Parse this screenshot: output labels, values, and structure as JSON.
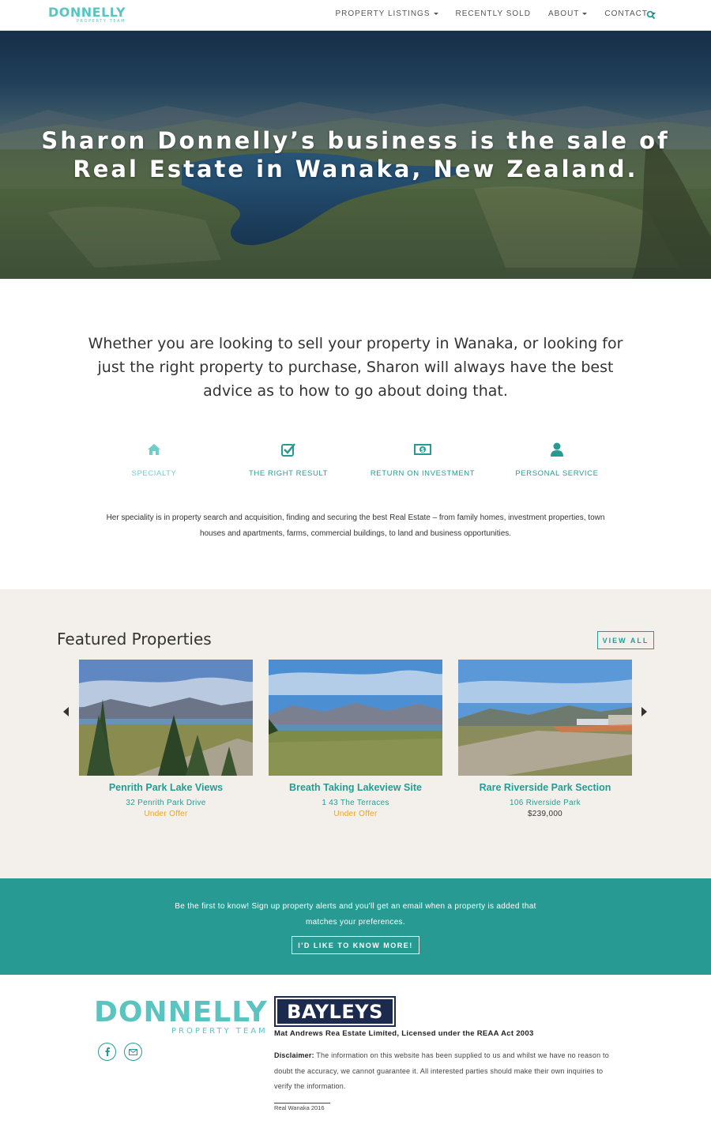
{
  "nav": {
    "logo_name": "DONNELLY",
    "logo_sub": "PROPERTY TEAM",
    "items": [
      {
        "label": "PROPERTY LISTINGS",
        "dropdown": true
      },
      {
        "label": "RECENTLY SOLD",
        "dropdown": false
      },
      {
        "label": "ABOUT",
        "dropdown": true
      },
      {
        "label": "CONTACT",
        "dropdown": true
      }
    ],
    "search_icon": "search-icon"
  },
  "hero": {
    "title": "Sharon Donnelly’s business is the sale of Real Estate in Wanaka, New Zealand."
  },
  "intro": {
    "text": "Whether you are looking to sell your property in Wanaka, or looking for just the right property to purchase, Sharon will always have the best advice as to how to go about doing that.",
    "features": [
      {
        "label": "SPECIALTY",
        "icon": "home-icon"
      },
      {
        "label": "THE RIGHT RESULT",
        "icon": "checkbox-icon"
      },
      {
        "label": "RETURN ON INVESTMENT",
        "icon": "money-icon"
      },
      {
        "label": "PERSONAL SERVICE",
        "icon": "user-icon"
      }
    ],
    "speciality": "Her speciality is in property search and acquisition, finding and securing the best Real Estate – from family homes, investment properties, town houses and apartments, farms, commercial buildings, to land and business opportunities."
  },
  "featured": {
    "title": "Featured Properties",
    "view_all": "VIEW ALL",
    "cards": [
      {
        "title": "Penrith Park Lake Views",
        "address": "32 Penrith Park Drive",
        "status": "Under Offer"
      },
      {
        "title": "Breath Taking Lakeview Site",
        "address": "1 43 The Terraces",
        "status": "Under Offer"
      },
      {
        "title": "Rare Riverside Park Section",
        "address": "106 Riverside Park",
        "status": "$239,000"
      }
    ]
  },
  "signup": {
    "text": "Be the first to know! Sign up property alerts and you'll get an email when a property is added that matches your preferences.",
    "button": "I'D LIKE TO KNOW MORE!"
  },
  "footer": {
    "logo_name": "DONNELLY",
    "logo_sub": "PROPERTY TEAM",
    "bayleys": "BAYLEYS",
    "licensed": "Mat Andrews Rea Estate Limited, Licensed under the REAA Act 2003",
    "disclaimer_label": "Disclaimer:",
    "disclaimer_text": "The information on this website has been supplied to us and whilst we have no reason to doubt the accuracy, we cannot guarantee it. All interested parties should make their own inquiries to verify the information.",
    "copyright": "Real Wanaka 2016"
  },
  "colors": {
    "teal": "#279b93",
    "teal_light": "#5bc4c1",
    "offer": "#e8a32d",
    "beige": "#f3f0eb",
    "navy": "#1c2a4e"
  }
}
